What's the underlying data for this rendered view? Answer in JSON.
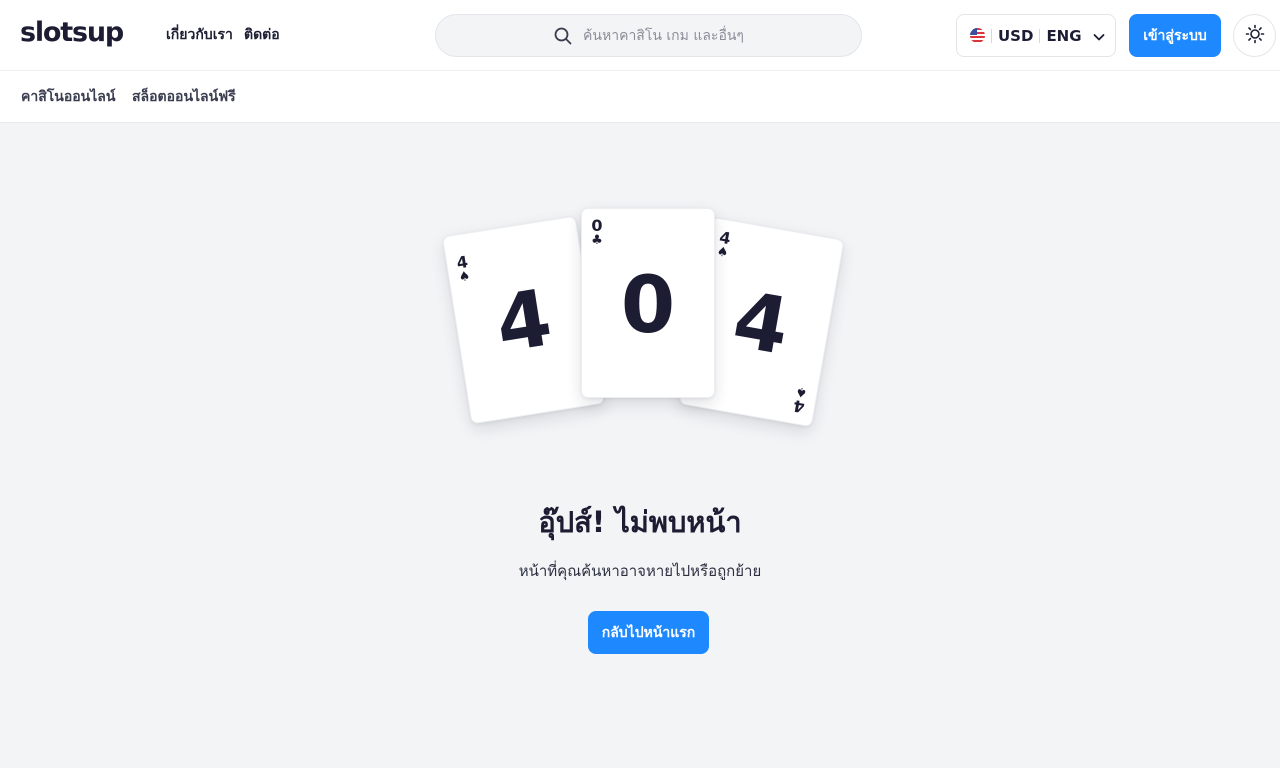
{
  "header": {
    "logo": "slotsup",
    "nav": [
      {
        "label": "เกี่ยวกับเรา"
      },
      {
        "label": "ติดต่อ"
      }
    ],
    "search": {
      "placeholder": "ค้นหาคาสิโน เกม และอื่นๆ",
      "icon": "search-icon"
    },
    "locale": {
      "flag": "us-flag-icon",
      "currency": "USD",
      "language": "ENG"
    },
    "login_label": "เข้าสู่ระบบ",
    "theme_icon": "sun-icon"
  },
  "subnav": {
    "items": [
      {
        "label": "คาสิโนออนไลน์"
      },
      {
        "label": "สล็อตออนไลน์ฟรี"
      }
    ]
  },
  "error": {
    "cards": [
      {
        "rank": "4",
        "suit": "♠"
      },
      {
        "rank": "0",
        "suit": "♣"
      },
      {
        "rank": "4",
        "suit": "♠"
      }
    ],
    "title": "อุ๊ปส์! ไม่พบหน้า",
    "message": "หน้าที่คุณค้นหาอาจหายไปหรือถูกย้าย",
    "button_label": "กลับไปหน้าแรก"
  },
  "colors": {
    "accent": "#1e88ff",
    "text": "#1c1d33",
    "background": "#f3f4f6"
  }
}
